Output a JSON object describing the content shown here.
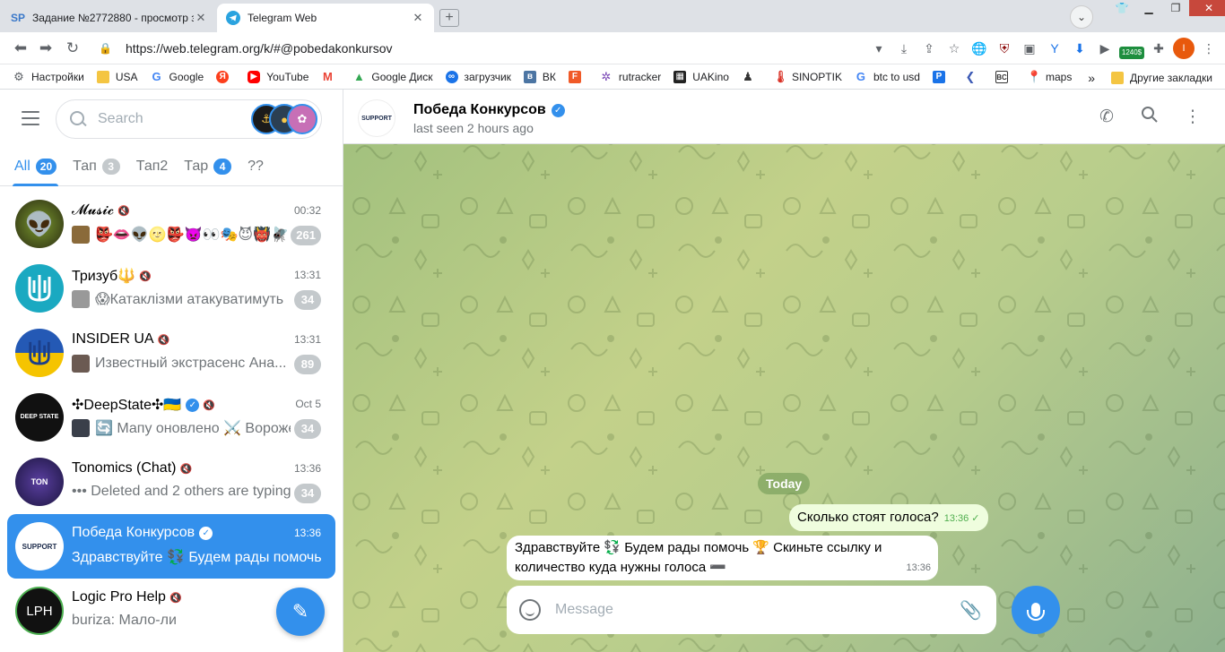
{
  "browser": {
    "tabs": [
      {
        "favicon": "SP",
        "title": "Задание №2772880 - просмотр за",
        "active": false
      },
      {
        "favicon": "telegram-icon",
        "title": "Telegram Web",
        "active": true
      }
    ],
    "url": "https://web.telegram.org/k/#@pobedakonkursov",
    "extension_badge": "1240$",
    "bookmarks": [
      {
        "label": "Настройки",
        "icon": "gear-icon",
        "color": "#5f6368"
      },
      {
        "label": "USA",
        "icon": "folder-icon",
        "color": "#f4c542"
      },
      {
        "label": "Google",
        "icon": "google-icon",
        "color": "#4285f4"
      },
      {
        "label": "",
        "icon": "yandex-icon",
        "color": "#fc3f1d"
      },
      {
        "label": "YouTube",
        "icon": "youtube-icon",
        "color": "#ff0000"
      },
      {
        "label": "",
        "icon": "gmail-icon",
        "color": "#ea4335"
      },
      {
        "label": "Google Диск",
        "icon": "drive-icon",
        "color": "#34a853"
      },
      {
        "label": "загрузчик",
        "icon": "infinity-icon",
        "color": "#1a73e8"
      },
      {
        "label": "ВК",
        "icon": "vk-icon",
        "color": "#4c75a3"
      },
      {
        "label": "",
        "icon": "f-icon",
        "color": "#f05a28"
      },
      {
        "label": "rutracker",
        "icon": "rutracker-icon",
        "color": "#7b4ab6"
      },
      {
        "label": "UAKino",
        "icon": "film-icon",
        "color": "#222222"
      },
      {
        "label": "",
        "icon": "person-icon",
        "color": "#333333"
      },
      {
        "label": "SINOPTIK",
        "icon": "thermometer-icon",
        "color": "#d93025"
      },
      {
        "label": "btc to usd",
        "icon": "google-icon",
        "color": "#4285f4"
      },
      {
        "label": "",
        "icon": "p-icon",
        "color": "#1a73e8"
      },
      {
        "label": "",
        "icon": "arrow-icon",
        "color": "#3c5ab5"
      },
      {
        "label": "",
        "icon": "bc-icon",
        "color": "#333333"
      },
      {
        "label": "maps",
        "icon": "maps-icon",
        "color": "#ea4335"
      }
    ],
    "overflow": "»",
    "other_bookmarks": "Другие закладки"
  },
  "sidebar": {
    "search_placeholder": "Search",
    "folders": [
      {
        "label": "All",
        "count": "20",
        "active": true
      },
      {
        "label": "Тап",
        "count": "3",
        "active": false
      },
      {
        "label": "Тап2",
        "count": "",
        "active": false
      },
      {
        "label": "Тар",
        "count": "4",
        "active": false
      },
      {
        "label": "??",
        "count": "",
        "active": false
      }
    ],
    "chats": [
      {
        "title": "𝓜𝓾𝓼𝓲𝓬",
        "muted": true,
        "verified": false,
        "time": "00:32",
        "preview": "👺👄👽🌝👺👿👀🎭😈👹🪰",
        "badge": "261",
        "avatar_color": "#3b3b1f",
        "avatar_text": "👽",
        "active": false
      },
      {
        "title": "Тризуб🔱",
        "muted": true,
        "verified": false,
        "time": "13:31",
        "preview": "😱Катаклізми атакуватимуть",
        "badge": "34",
        "avatar_color": "#1aa9c1",
        "avatar_text": "Ш",
        "active": false
      },
      {
        "title": "INSIDER UA",
        "muted": true,
        "verified": false,
        "time": "13:31",
        "preview": "Известный экстрасенс Ана...",
        "badge": "89",
        "avatar_color": "#1e4fa8",
        "avatar_text": "Ш",
        "active": false
      },
      {
        "title": "✣DeepState✣🇺🇦",
        "muted": true,
        "verified": true,
        "time": "Oct 5",
        "preview": "🔄 Мапу оновлено ⚔️ Вороже",
        "badge": "34",
        "avatar_color": "#111111",
        "avatar_text": "DEEP STATE",
        "active": false
      },
      {
        "title": "Tonomics (Chat)",
        "muted": true,
        "verified": false,
        "time": "13:36",
        "preview": "••• Deleted and 2 others are typing",
        "badge": "34",
        "avatar_color": "#3a2a6a",
        "avatar_text": "TON",
        "active": false
      },
      {
        "title": "Победа Конкурсов",
        "muted": false,
        "verified": true,
        "time": "13:36",
        "preview": "Здравствуйте 💱 Будем рады помочь",
        "badge": "",
        "avatar_color": "#ffffff",
        "avatar_text": "SUPPORT",
        "active": true
      },
      {
        "title": "Logic Pro Help",
        "muted": true,
        "verified": false,
        "time": "",
        "preview": "buriza: Мало-ли",
        "badge": "",
        "avatar_color": "#111111",
        "avatar_text": "LPH",
        "active": false
      }
    ]
  },
  "chat": {
    "title": "Победа Конкурсов",
    "status": "last seen 2 hours ago",
    "avatar_text": "SUPPORT",
    "date_separator": "Today",
    "outgoing": {
      "text": "Сколько стоят голоса?",
      "time": "13:36",
      "read_mark": "✓"
    },
    "incoming": {
      "text": "Здравствуйте 💱 Будем рады помочь 🏆 Скиньте ссылку и количество куда нужны голоса ➖",
      "time": "13:36"
    },
    "composer_placeholder": "Message"
  }
}
